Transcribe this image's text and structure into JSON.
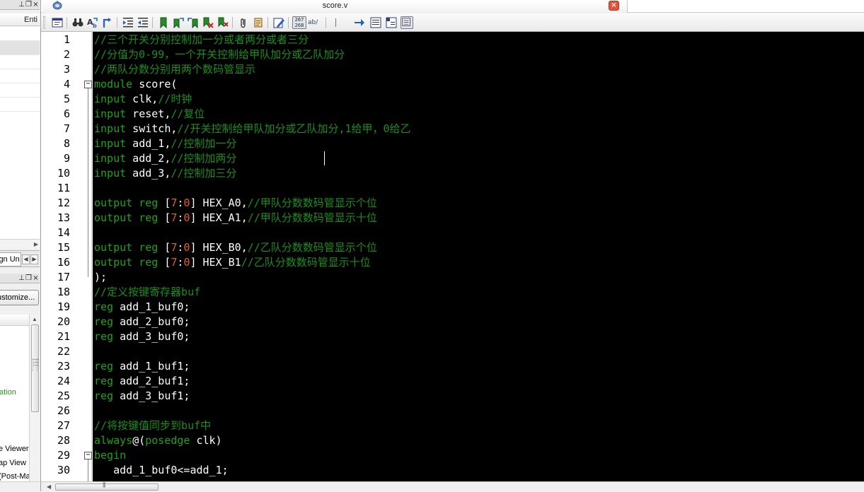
{
  "left_panel": {
    "project": {
      "column_header": "Enti"
    },
    "tab": {
      "label": "ign Un"
    },
    "tasks": {
      "customize_label": "ustomize...",
      "items": [
        {
          "label": "ation",
          "color": "#2f8f1f"
        },
        {
          "label": "e Viewer"
        },
        {
          "label": "ap View"
        },
        {
          "label": "(Post-Ma"
        }
      ]
    }
  },
  "editor": {
    "tab_title": "score.v",
    "close_glyph": "×",
    "toolbar": {
      "icons": [
        "insert-template-icon",
        "find-icon",
        "find-replace-icon",
        "goto-line-icon",
        "increase-indent-icon",
        "decrease-indent-icon",
        "toggle-bookmark-icon",
        "next-bookmark-icon",
        "previous-bookmark-icon",
        "clear-bookmarks-icon",
        "attach-icon",
        "script-icon",
        "edit-icon",
        "line-numbers-icon",
        "spelling-icon",
        "jump-icon",
        "block-comment-icon",
        "uncomment-icon",
        "word-wrap-icon"
      ],
      "line_number_badge_top": "267",
      "line_number_badge_bottom": "268",
      "spell_badge": "ab/"
    },
    "colors": {
      "background": "#000000",
      "keyword": "#1fa317",
      "comment": "#1a8f1a",
      "number": "#e25f22",
      "text": "#ffffff"
    },
    "line_numbers": [
      "1",
      "2",
      "3",
      "4",
      "5",
      "6",
      "7",
      "8",
      "9",
      "10",
      "11",
      "12",
      "13",
      "14",
      "15",
      "16",
      "17",
      "18",
      "19",
      "20",
      "21",
      "22",
      "23",
      "24",
      "25",
      "26",
      "27",
      "28",
      "29",
      "30"
    ],
    "lines": [
      [
        {
          "t": "//三个开关分别控制加一分或者两分或者三分",
          "c": "cm"
        }
      ],
      [
        {
          "t": "//分值为0-99，一个开关控制给甲队加分或乙队加分",
          "c": "cm"
        }
      ],
      [
        {
          "t": "//两队分数分别用两个数码管显示",
          "c": "cm"
        }
      ],
      [
        {
          "t": "module",
          "c": "kw"
        },
        {
          "t": " score(",
          "c": ""
        }
      ],
      [
        {
          "t": "input",
          "c": "kw"
        },
        {
          "t": " clk,",
          "c": ""
        },
        {
          "t": "//时钟",
          "c": "cm"
        }
      ],
      [
        {
          "t": "input",
          "c": "kw"
        },
        {
          "t": " reset,",
          "c": ""
        },
        {
          "t": "//复位",
          "c": "cm"
        }
      ],
      [
        {
          "t": "input",
          "c": "kw"
        },
        {
          "t": " switch,",
          "c": ""
        },
        {
          "t": "//开关控制给甲队加分或乙队加分,1给甲，0给乙",
          "c": "cm"
        }
      ],
      [
        {
          "t": "input",
          "c": "kw"
        },
        {
          "t": " add_1,",
          "c": ""
        },
        {
          "t": "//控制加一分",
          "c": "cm"
        }
      ],
      [
        {
          "t": "input",
          "c": "kw"
        },
        {
          "t": " add_2,",
          "c": ""
        },
        {
          "t": "//控制加两分",
          "c": "cm"
        }
      ],
      [
        {
          "t": "input",
          "c": "kw"
        },
        {
          "t": " add_3,",
          "c": ""
        },
        {
          "t": "//控制加三分",
          "c": "cm"
        }
      ],
      [],
      [
        {
          "t": "output",
          "c": "kw"
        },
        {
          "t": " ",
          "c": ""
        },
        {
          "t": "reg",
          "c": "kw"
        },
        {
          "t": " [",
          "c": ""
        },
        {
          "t": "7",
          "c": "num"
        },
        {
          "t": ":",
          "c": ""
        },
        {
          "t": "0",
          "c": "num"
        },
        {
          "t": "] HEX_A0,",
          "c": ""
        },
        {
          "t": "//甲队分数数码管显示个位",
          "c": "cm"
        }
      ],
      [
        {
          "t": "output",
          "c": "kw"
        },
        {
          "t": " ",
          "c": ""
        },
        {
          "t": "reg",
          "c": "kw"
        },
        {
          "t": " [",
          "c": ""
        },
        {
          "t": "7",
          "c": "num"
        },
        {
          "t": ":",
          "c": ""
        },
        {
          "t": "0",
          "c": "num"
        },
        {
          "t": "] HEX_A1,",
          "c": ""
        },
        {
          "t": "//甲队分数数码管显示十位",
          "c": "cm"
        }
      ],
      [],
      [
        {
          "t": "output",
          "c": "kw"
        },
        {
          "t": " ",
          "c": ""
        },
        {
          "t": "reg",
          "c": "kw"
        },
        {
          "t": " [",
          "c": ""
        },
        {
          "t": "7",
          "c": "num"
        },
        {
          "t": ":",
          "c": ""
        },
        {
          "t": "0",
          "c": "num"
        },
        {
          "t": "] HEX_B0,",
          "c": ""
        },
        {
          "t": "//乙队分数数码管显示个位",
          "c": "cm"
        }
      ],
      [
        {
          "t": "output",
          "c": "kw"
        },
        {
          "t": " ",
          "c": ""
        },
        {
          "t": "reg",
          "c": "kw"
        },
        {
          "t": " [",
          "c": ""
        },
        {
          "t": "7",
          "c": "num"
        },
        {
          "t": ":",
          "c": ""
        },
        {
          "t": "0",
          "c": "num"
        },
        {
          "t": "] HEX_B1",
          "c": ""
        },
        {
          "t": "//乙队分数数码管显示十位",
          "c": "cm"
        }
      ],
      [
        {
          "t": ");",
          "c": ""
        }
      ],
      [
        {
          "t": "//定义按键寄存器buf",
          "c": "cm"
        }
      ],
      [
        {
          "t": "reg",
          "c": "kw"
        },
        {
          "t": " add_1_buf0;",
          "c": ""
        }
      ],
      [
        {
          "t": "reg",
          "c": "kw"
        },
        {
          "t": " add_2_buf0;",
          "c": ""
        }
      ],
      [
        {
          "t": "reg",
          "c": "kw"
        },
        {
          "t": " add_3_buf0;",
          "c": ""
        }
      ],
      [],
      [
        {
          "t": "reg",
          "c": "kw"
        },
        {
          "t": " add_1_buf1;",
          "c": ""
        }
      ],
      [
        {
          "t": "reg",
          "c": "kw"
        },
        {
          "t": " add_2_buf1;",
          "c": ""
        }
      ],
      [
        {
          "t": "reg",
          "c": "kw"
        },
        {
          "t": " add_3_buf1;",
          "c": ""
        }
      ],
      [],
      [
        {
          "t": "//将按键值同步到buf中",
          "c": "cm"
        }
      ],
      [
        {
          "t": "always",
          "c": "kw"
        },
        {
          "t": "@(",
          "c": ""
        },
        {
          "t": "posedge",
          "c": "kw"
        },
        {
          "t": " clk)",
          "c": ""
        }
      ],
      [
        {
          "t": "begin",
          "c": "kw"
        }
      ],
      [
        {
          "t": "   add_1_buf0<=add_1;",
          "c": ""
        }
      ]
    ]
  }
}
